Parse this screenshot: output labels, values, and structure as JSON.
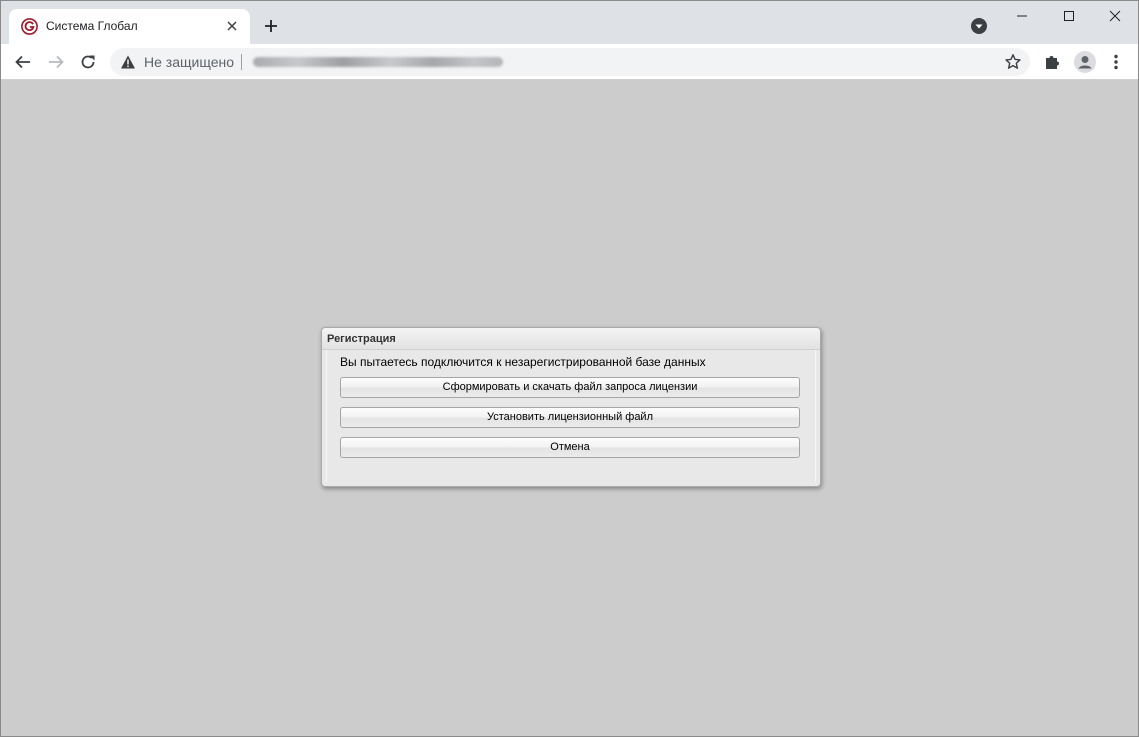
{
  "browser": {
    "tab": {
      "title": "Система Глобал",
      "favicon": "globus-logo-icon"
    },
    "omnibox": {
      "security_label": "Не защищено",
      "url_visible": false
    },
    "colors": {
      "tab_strip": "#dee1e6",
      "toolbar": "#ffffff",
      "omnibox": "#f1f3f4",
      "page_background": "#cccccc",
      "favicon_accent": "#9b1c2e"
    }
  },
  "dialog": {
    "title": "Регистрация",
    "message": "Вы пытаетесь подключится к незарегистрированной базе данных",
    "buttons": {
      "request_license": "Сформировать и скачать файл запроса лицензии",
      "install_license": "Установить лицензионный файл",
      "cancel": "Отмена"
    }
  }
}
